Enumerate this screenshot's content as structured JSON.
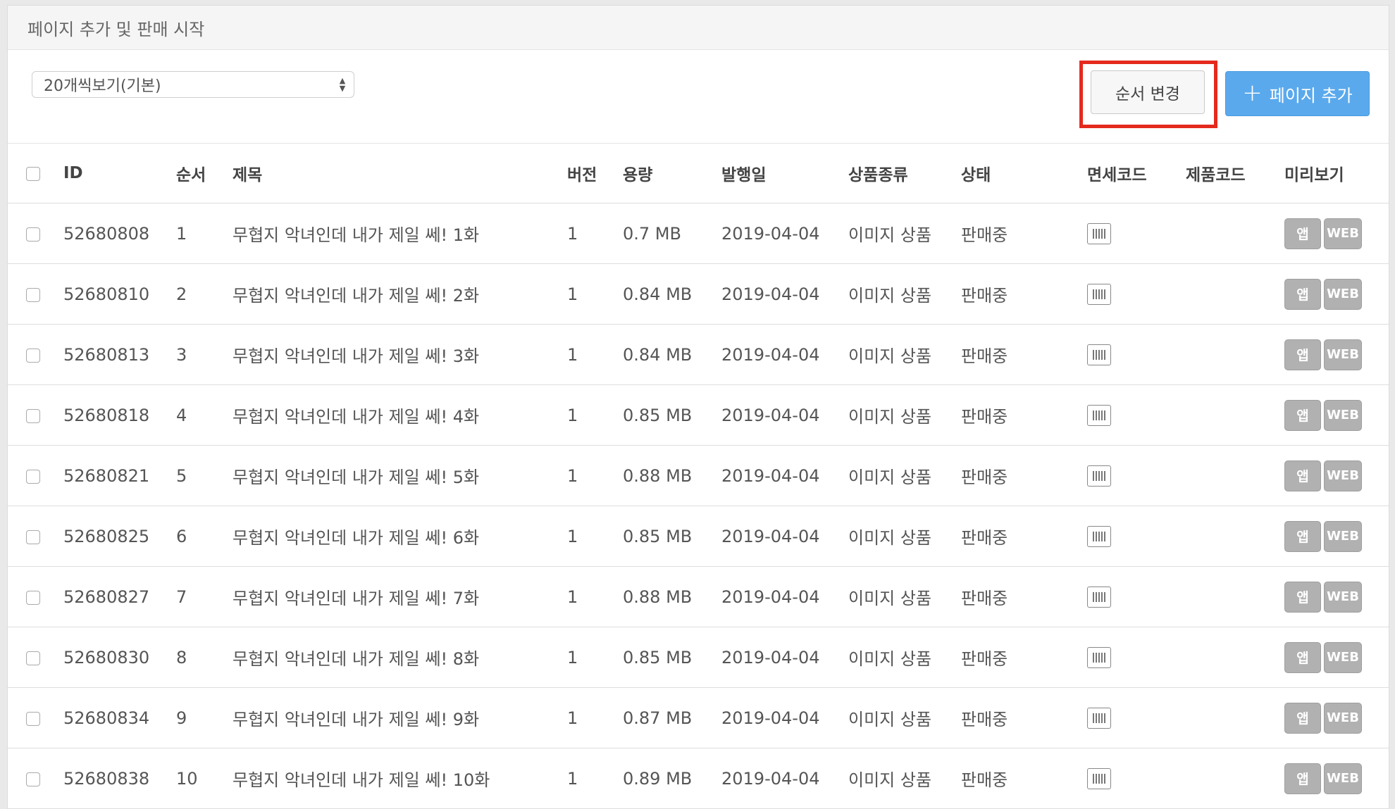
{
  "panel": {
    "title": "페이지 추가 및 판매 시작"
  },
  "toolbar": {
    "page_size_select": "20개씩보기(기본)",
    "order_button": "순서 변경",
    "add_button_icon": "plus-icon",
    "add_button": "페이지 추가"
  },
  "table": {
    "headers": {
      "id": "ID",
      "order": "순서",
      "title": "제목",
      "version": "버전",
      "size": "용량",
      "date": "발행일",
      "type": "상품종류",
      "status": "상태",
      "dutyfree": "면세코드",
      "product": "제품코드",
      "preview": "미리보기"
    },
    "preview_labels": {
      "app": "앱",
      "web": "WEB"
    },
    "rows": [
      {
        "id": "52680808",
        "order": "1",
        "title": "무협지 악녀인데 내가 제일 쎄! 1화",
        "version": "1",
        "size": "0.7 MB",
        "date": "2019-04-04",
        "type": "이미지 상품",
        "status": "판매중"
      },
      {
        "id": "52680810",
        "order": "2",
        "title": "무협지 악녀인데 내가 제일 쎄! 2화",
        "version": "1",
        "size": "0.84 MB",
        "date": "2019-04-04",
        "type": "이미지 상품",
        "status": "판매중"
      },
      {
        "id": "52680813",
        "order": "3",
        "title": "무협지 악녀인데 내가 제일 쎄! 3화",
        "version": "1",
        "size": "0.84 MB",
        "date": "2019-04-04",
        "type": "이미지 상품",
        "status": "판매중"
      },
      {
        "id": "52680818",
        "order": "4",
        "title": "무협지 악녀인데 내가 제일 쎄! 4화",
        "version": "1",
        "size": "0.85 MB",
        "date": "2019-04-04",
        "type": "이미지 상품",
        "status": "판매중"
      },
      {
        "id": "52680821",
        "order": "5",
        "title": "무협지 악녀인데 내가 제일 쎄! 5화",
        "version": "1",
        "size": "0.88 MB",
        "date": "2019-04-04",
        "type": "이미지 상품",
        "status": "판매중"
      },
      {
        "id": "52680825",
        "order": "6",
        "title": "무협지 악녀인데 내가 제일 쎄! 6화",
        "version": "1",
        "size": "0.85 MB",
        "date": "2019-04-04",
        "type": "이미지 상품",
        "status": "판매중"
      },
      {
        "id": "52680827",
        "order": "7",
        "title": "무협지 악녀인데 내가 제일 쎄! 7화",
        "version": "1",
        "size": "0.88 MB",
        "date": "2019-04-04",
        "type": "이미지 상품",
        "status": "판매중"
      },
      {
        "id": "52680830",
        "order": "8",
        "title": "무협지 악녀인데 내가 제일 쎄! 8화",
        "version": "1",
        "size": "0.85 MB",
        "date": "2019-04-04",
        "type": "이미지 상품",
        "status": "판매중"
      },
      {
        "id": "52680834",
        "order": "9",
        "title": "무협지 악녀인데 내가 제일 쎄! 9화",
        "version": "1",
        "size": "0.87 MB",
        "date": "2019-04-04",
        "type": "이미지 상품",
        "status": "판매중"
      },
      {
        "id": "52680838",
        "order": "10",
        "title": "무협지 악녀인데 내가 제일 쎄! 10화",
        "version": "1",
        "size": "0.89 MB",
        "date": "2019-04-04",
        "type": "이미지 상품",
        "status": "판매중"
      }
    ]
  },
  "colors": {
    "highlight": "#e42a1d",
    "primary_button": "#5aa9ec",
    "preview_badge": "#b1b1b1"
  }
}
